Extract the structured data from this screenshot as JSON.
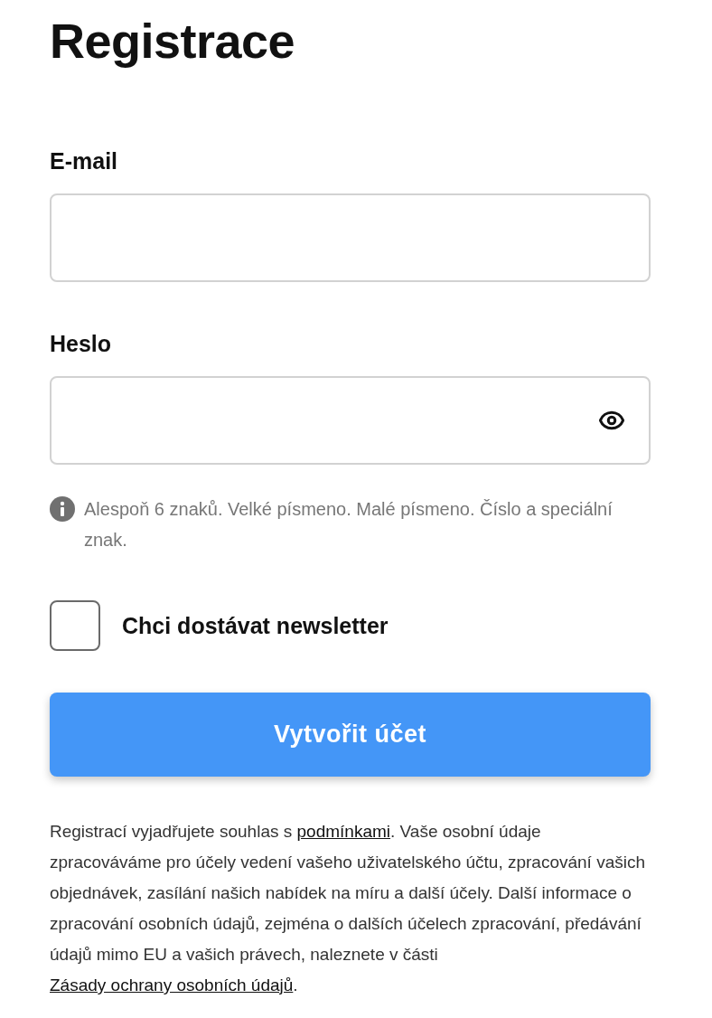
{
  "title": "Registrace",
  "fields": [
    {
      "label": "E-mail",
      "kind": "email"
    },
    {
      "label": "Heslo",
      "kind": "password"
    }
  ],
  "hint": "Alespoň 6 znaků. Velké písmeno. Malé písmeno. Číslo a speciální znak.",
  "newsletter": {
    "label": "Chci dostávat newsletter",
    "checked": false
  },
  "submit": "Vytvořit účet",
  "legal": [
    {
      "kind": "text",
      "text": "Registrací vyjadřujete souhlas s "
    },
    {
      "kind": "link",
      "text": "podmínkami"
    },
    {
      "kind": "text",
      "text": ". Vaše osobní údaje zpracováváme pro účely vedení vašeho uživatelského účtu, zpracování vašich objednávek, zasílání našich nabídek na míru a další účely. Další informace o zpracování osobních údajů, zejména o dalších účelech zpracování, předávání údajů mimo EU a vašich právech, naleznete v části "
    },
    {
      "kind": "link",
      "text": "Zásady ochrany osobních údajů"
    },
    {
      "kind": "text",
      "text": "."
    }
  ]
}
